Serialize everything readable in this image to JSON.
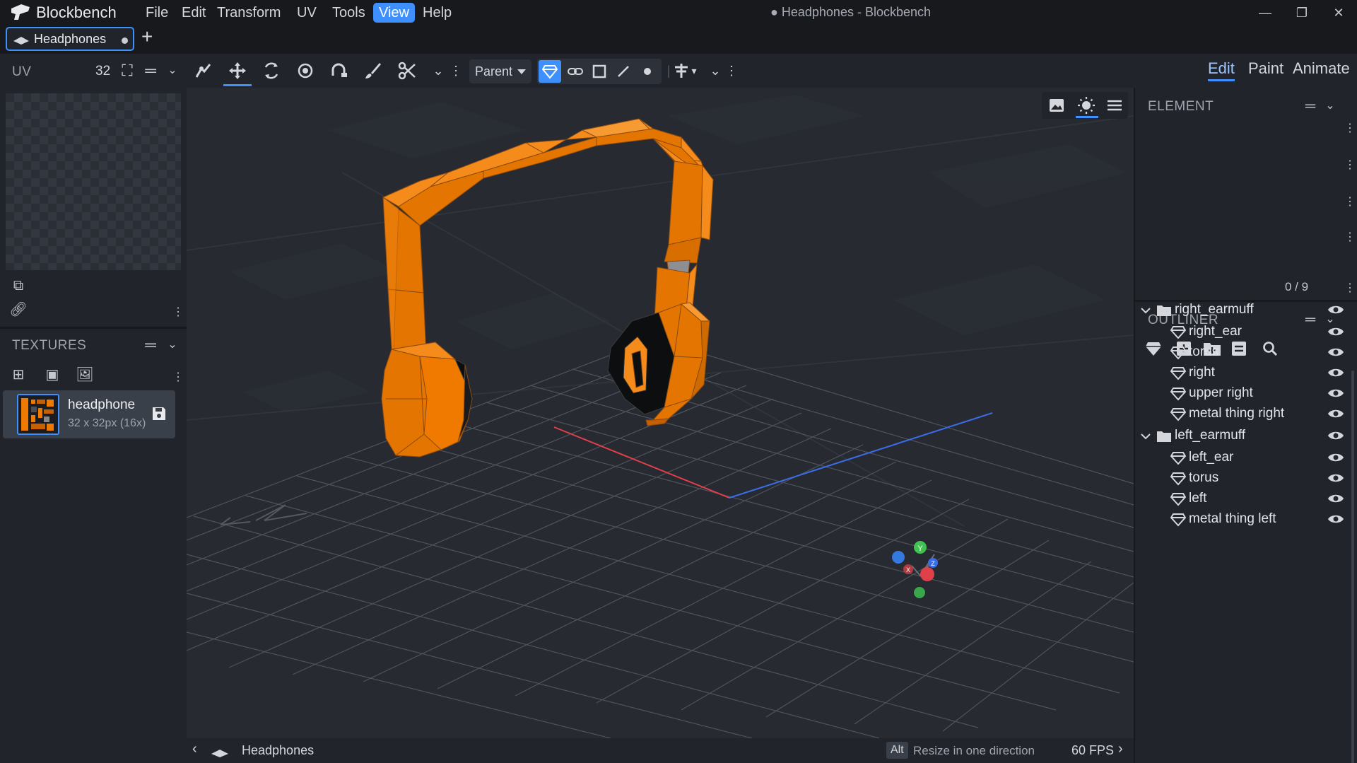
{
  "app": {
    "name": "Blockbench",
    "window_title": "● Headphones - Blockbench"
  },
  "menu": [
    "File",
    "Edit",
    "Transform",
    "UV",
    "Tools",
    "View",
    "Help"
  ],
  "active_menu": "View",
  "tabs": [
    {
      "label": "Headphones",
      "unsaved": true
    }
  ],
  "toolbar": {
    "transform_space": "Parent",
    "modes": [
      "Edit",
      "Paint",
      "Animate"
    ],
    "active_mode": "Edit"
  },
  "uv_panel": {
    "title": "UV",
    "size": "32"
  },
  "textures_panel": {
    "title": "TEXTURES",
    "items": [
      {
        "name": "headphone",
        "meta": "32 x 32px (16x)"
      }
    ]
  },
  "element_panel": {
    "title": "ELEMENT"
  },
  "outliner": {
    "title": "OUTLINER",
    "count": "0 / 9",
    "groups": [
      {
        "name": "right_earmuff",
        "children": [
          "right_ear",
          "torus",
          "right",
          "upper right",
          "metal thing right"
        ]
      },
      {
        "name": "left_earmuff",
        "children": [
          "left_ear",
          "torus",
          "left",
          "metal thing left"
        ]
      }
    ]
  },
  "status": {
    "model_name": "Headphones",
    "key": "Alt",
    "hint": "Resize in one direction",
    "fps": "60 FPS"
  },
  "colors": {
    "accent": "#3e90ff",
    "model": "#f07a00",
    "background": "#272a30"
  },
  "gizmo_axes": [
    "Y",
    "X",
    "Z"
  ]
}
